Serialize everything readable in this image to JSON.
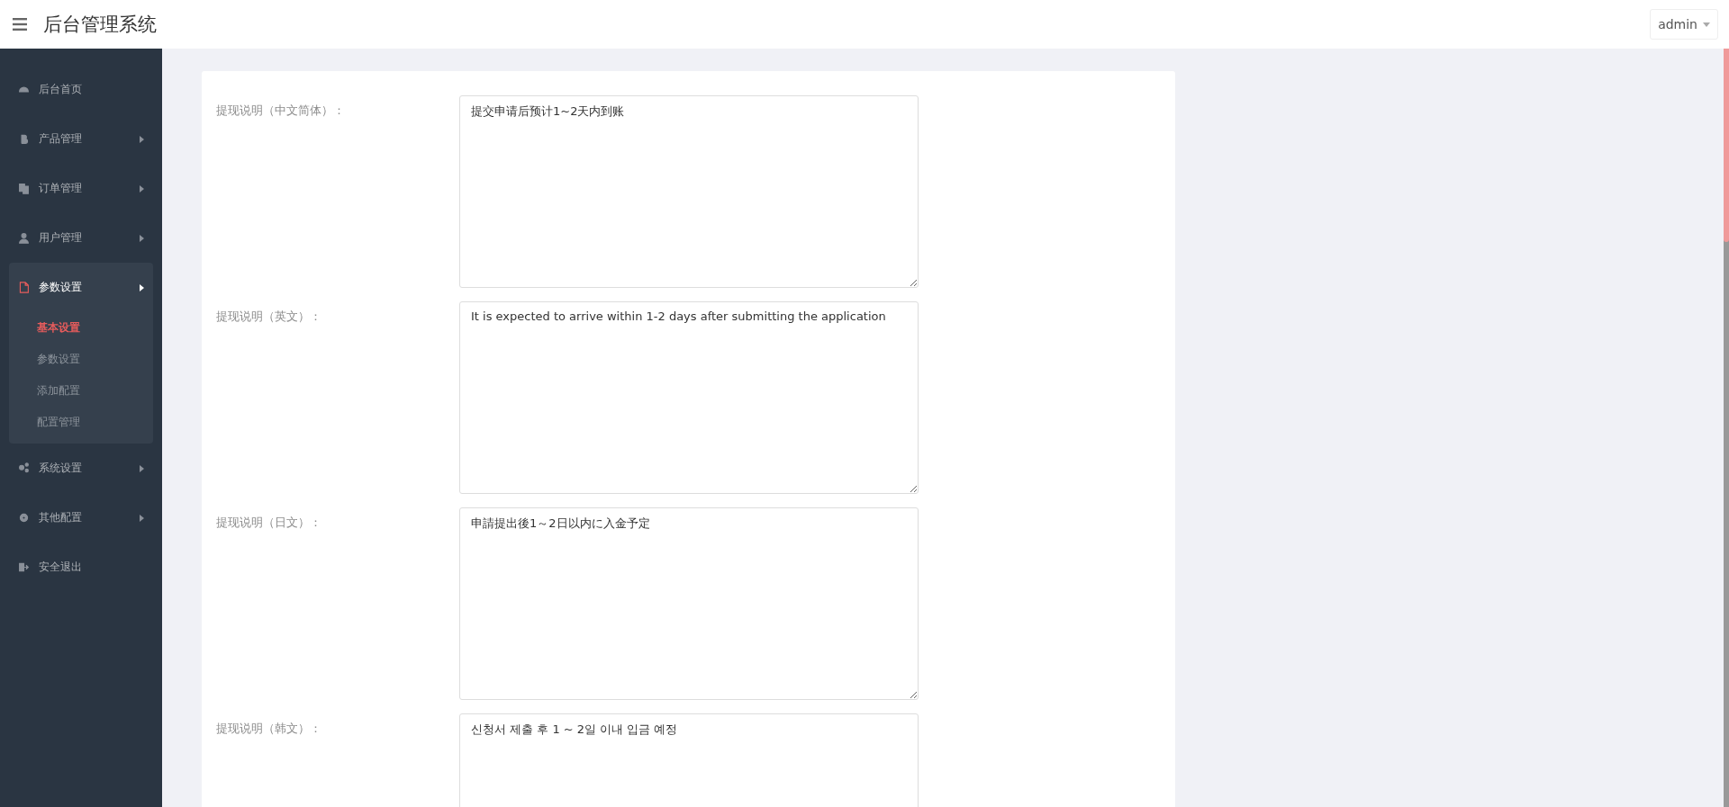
{
  "header": {
    "title": "后台管理系统",
    "user_menu": "admin"
  },
  "sidebar": {
    "items": [
      {
        "label": "后台首页",
        "expandable": false,
        "expanded": false
      },
      {
        "label": "产品管理",
        "expandable": true,
        "expanded": false
      },
      {
        "label": "订单管理",
        "expandable": true,
        "expanded": false
      },
      {
        "label": "用户管理",
        "expandable": true,
        "expanded": false
      },
      {
        "label": "参数设置",
        "expandable": true,
        "expanded": true,
        "children": [
          {
            "label": "基本设置",
            "selected": true
          },
          {
            "label": "参数设置",
            "selected": false
          },
          {
            "label": "添加配置",
            "selected": false
          },
          {
            "label": "配置管理",
            "selected": false
          }
        ]
      },
      {
        "label": "系统设置",
        "expandable": true,
        "expanded": false
      },
      {
        "label": "其他配置",
        "expandable": true,
        "expanded": false
      },
      {
        "label": "安全退出",
        "expandable": false,
        "expanded": false
      }
    ]
  },
  "form": {
    "fields": [
      {
        "label": "提现说明（中文简体）：",
        "value": "提交申请后预计1~2天内到账"
      },
      {
        "label": "提现说明（英文）：",
        "value": "It is expected to arrive within 1-2 days after submitting the application"
      },
      {
        "label": "提现说明（日文）：",
        "value": "申請提出後1～2日以内に入金予定"
      },
      {
        "label": "提现说明（韩文）：",
        "value": "신청서 제출 후 1 ~ 2일 이내 입금 예정"
      }
    ]
  }
}
